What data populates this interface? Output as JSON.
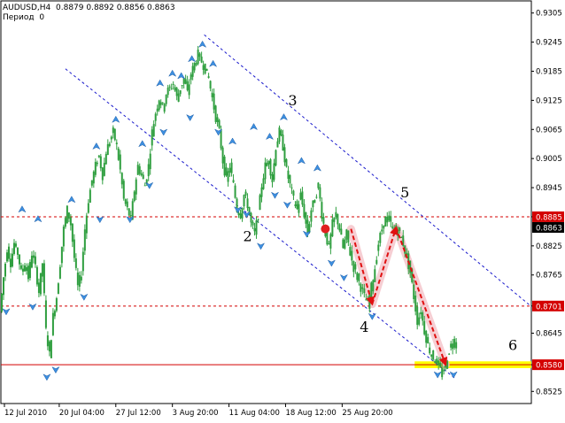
{
  "header": {
    "symbol": "AUDUSD,H4",
    "ohlc": "0.8879 0.8892 0.8856 0.8863",
    "period_label": "Период",
    "period_value": "0"
  },
  "chart_data": {
    "type": "candlestick",
    "title": "AUDUSD,H4",
    "x_ticks": [
      "12 Jul 2010",
      "20 Jul 04:00",
      "27 Jul 12:00",
      "3 Aug 20:00",
      "11 Aug 04:00",
      "18 Aug 12:00",
      "25 Aug 20:00"
    ],
    "y_ticks": [
      "0.9305",
      "0.9245",
      "0.9185",
      "0.9125",
      "0.9065",
      "0.9005",
      "0.8945",
      "0.8885",
      "0.8825",
      "0.8765",
      "0.8701",
      "0.8645",
      "0.8580",
      "0.8525"
    ],
    "ylim": [
      0.85,
      0.933
    ],
    "price_path": [
      [
        0,
        0.869
      ],
      [
        4,
        0.876
      ],
      [
        8,
        0.882
      ],
      [
        12,
        0.879
      ],
      [
        16,
        0.883
      ],
      [
        20,
        0.881
      ],
      [
        24,
        0.877
      ],
      [
        28,
        0.879
      ],
      [
        32,
        0.876
      ],
      [
        36,
        0.881
      ],
      [
        40,
        0.878
      ],
      [
        44,
        0.873
      ],
      [
        48,
        0.879
      ],
      [
        52,
        0.865
      ],
      [
        56,
        0.86
      ],
      [
        60,
        0.868
      ],
      [
        64,
        0.872
      ],
      [
        68,
        0.879
      ],
      [
        72,
        0.886
      ],
      [
        76,
        0.89
      ],
      [
        80,
        0.887
      ],
      [
        84,
        0.88
      ],
      [
        88,
        0.874
      ],
      [
        92,
        0.877
      ],
      [
        96,
        0.886
      ],
      [
        100,
        0.892
      ],
      [
        104,
        0.896
      ],
      [
        108,
        0.899
      ],
      [
        112,
        0.901
      ],
      [
        116,
        0.897
      ],
      [
        120,
        0.902
      ],
      [
        124,
        0.904
      ],
      [
        128,
        0.906
      ],
      [
        132,
        0.903
      ],
      [
        136,
        0.898
      ],
      [
        140,
        0.892
      ],
      [
        144,
        0.89
      ],
      [
        148,
        0.888
      ],
      [
        152,
        0.894
      ],
      [
        156,
        0.899
      ],
      [
        160,
        0.897
      ],
      [
        164,
        0.895
      ],
      [
        168,
        0.899
      ],
      [
        172,
        0.906
      ],
      [
        176,
        0.91
      ],
      [
        180,
        0.913
      ],
      [
        184,
        0.911
      ],
      [
        188,
        0.914
      ],
      [
        192,
        0.915
      ],
      [
        196,
        0.916
      ],
      [
        200,
        0.913
      ],
      [
        204,
        0.915
      ],
      [
        208,
        0.917
      ],
      [
        212,
        0.914
      ],
      [
        216,
        0.918
      ],
      [
        220,
        0.92
      ],
      [
        224,
        0.922
      ],
      [
        228,
        0.9205
      ],
      [
        232,
        0.919
      ],
      [
        236,
        0.917
      ],
      [
        240,
        0.913
      ],
      [
        244,
        0.909
      ],
      [
        248,
        0.906
      ],
      [
        252,
        0.9
      ],
      [
        256,
        0.896
      ],
      [
        260,
        0.899
      ],
      [
        264,
        0.895
      ],
      [
        268,
        0.89
      ],
      [
        272,
        0.889
      ],
      [
        276,
        0.893
      ],
      [
        280,
        0.891
      ],
      [
        284,
        0.887
      ],
      [
        288,
        0.885
      ],
      [
        292,
        0.889
      ],
      [
        296,
        0.895
      ],
      [
        300,
        0.899
      ],
      [
        304,
        0.9
      ],
      [
        308,
        0.896
      ],
      [
        312,
        0.903
      ],
      [
        316,
        0.906
      ],
      [
        320,
        0.903
      ],
      [
        324,
        0.898
      ],
      [
        328,
        0.895
      ],
      [
        332,
        0.892
      ],
      [
        336,
        0.89
      ],
      [
        340,
        0.893
      ],
      [
        344,
        0.889
      ],
      [
        348,
        0.885
      ],
      [
        352,
        0.89
      ],
      [
        356,
        0.892
      ],
      [
        360,
        0.895
      ],
      [
        364,
        0.889
      ],
      [
        368,
        0.885
      ],
      [
        372,
        0.882
      ],
      [
        376,
        0.887
      ],
      [
        380,
        0.889
      ],
      [
        384,
        0.886
      ],
      [
        388,
        0.882
      ],
      [
        392,
        0.885
      ],
      [
        396,
        0.881
      ],
      [
        400,
        0.878
      ],
      [
        404,
        0.876
      ],
      [
        408,
        0.874
      ],
      [
        412,
        0.872
      ],
      [
        416,
        0.8705
      ],
      [
        420,
        0.874
      ],
      [
        424,
        0.878
      ],
      [
        428,
        0.883
      ],
      [
        432,
        0.886
      ],
      [
        436,
        0.888
      ],
      [
        440,
        0.888
      ],
      [
        444,
        0.886
      ],
      [
        448,
        0.886
      ],
      [
        452,
        0.885
      ],
      [
        456,
        0.883
      ],
      [
        460,
        0.88
      ],
      [
        464,
        0.877
      ],
      [
        468,
        0.872
      ],
      [
        472,
        0.867
      ],
      [
        476,
        0.869
      ],
      [
        480,
        0.865
      ],
      [
        484,
        0.862
      ],
      [
        488,
        0.86
      ],
      [
        492,
        0.859
      ],
      [
        496,
        0.858
      ],
      [
        500,
        0.856
      ],
      [
        504,
        0.858
      ],
      [
        508,
        0.861
      ],
      [
        512,
        0.863
      ],
      [
        516,
        0.862
      ]
    ],
    "horizontal_levels": [
      {
        "value": 0.8885,
        "style": "dashed",
        "color": "#d40000",
        "label": "0.8885"
      },
      {
        "value": 0.8701,
        "style": "dashed",
        "color": "#d40000",
        "label": "0.8701"
      },
      {
        "value": 0.858,
        "style": "solid",
        "color": "#d40000",
        "label": "0.8580"
      }
    ],
    "current_price": {
      "value": 0.8863,
      "label": "0.8863"
    },
    "target_zone": {
      "x_from": 468,
      "x_to": 600,
      "value_low": 0.8573,
      "value_high": 0.8587,
      "color": "#ffff00"
    },
    "channel_lines": [
      {
        "from": [
          73,
          0.919
        ],
        "to": [
          515,
          0.855
        ],
        "style": "dashed",
        "color": "#1a1acc"
      },
      {
        "from": [
          230,
          0.926
        ],
        "to": [
          600,
          0.87
        ],
        "style": "dashed",
        "color": "#1a1acc"
      }
    ],
    "wave_labels": [
      {
        "text": "2",
        "x": 279,
        "y": 0.8835
      },
      {
        "text": "3",
        "x": 330,
        "y": 0.9115
      },
      {
        "text": "4",
        "x": 411,
        "y": 0.8648
      },
      {
        "text": "5",
        "x": 457,
        "y": 0.8925
      },
      {
        "text": "6",
        "x": 579,
        "y": 0.861
      }
    ],
    "forecast_arrows": [
      {
        "from": [
          396,
          0.886
        ],
        "to": [
          420,
          0.8705
        ]
      },
      {
        "from": [
          420,
          0.8705
        ],
        "to": [
          447,
          0.8863
        ]
      },
      {
        "from": [
          447,
          0.8863
        ],
        "to": [
          503,
          0.858
        ]
      }
    ],
    "marker": {
      "x": 367,
      "y": 0.886,
      "color": "#e02020"
    },
    "fractals_up": [
      [
        24,
        0.89
      ],
      [
        42,
        0.888
      ],
      [
        80,
        0.892
      ],
      [
        108,
        0.903
      ],
      [
        130,
        0.9085
      ],
      [
        160,
        0.9035
      ],
      [
        180,
        0.916
      ],
      [
        194,
        0.918
      ],
      [
        204,
        0.9175
      ],
      [
        216,
        0.921
      ],
      [
        228,
        0.924
      ],
      [
        240,
        0.92
      ],
      [
        262,
        0.904
      ],
      [
        286,
        0.907
      ],
      [
        304,
        0.905
      ],
      [
        320,
        0.909
      ],
      [
        340,
        0.9
      ],
      [
        358,
        0.8985
      ]
    ],
    "fractals_down": [
      [
        6,
        0.869
      ],
      [
        36,
        0.87
      ],
      [
        52,
        0.8555
      ],
      [
        62,
        0.857
      ],
      [
        94,
        0.872
      ],
      [
        112,
        0.888
      ],
      [
        146,
        0.888
      ],
      [
        168,
        0.895
      ],
      [
        184,
        0.906
      ],
      [
        214,
        0.909
      ],
      [
        246,
        0.906
      ],
      [
        268,
        0.89
      ],
      [
        278,
        0.889
      ],
      [
        294,
        0.8825
      ],
      [
        310,
        0.893
      ],
      [
        324,
        0.891
      ],
      [
        346,
        0.885
      ],
      [
        374,
        0.879
      ],
      [
        388,
        0.876
      ],
      [
        420,
        0.868
      ],
      [
        494,
        0.856
      ],
      [
        512,
        0.856
      ]
    ]
  }
}
